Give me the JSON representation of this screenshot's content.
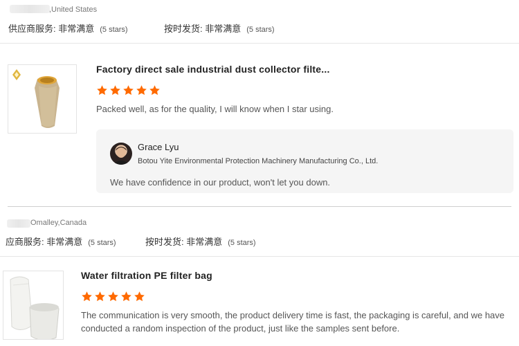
{
  "reviews": [
    {
      "location": ",United States",
      "supplier_service_label": "供应商服务: 非常满意",
      "supplier_service_note": "(5 stars)",
      "ontime_label": "按时发货: 非常满意",
      "ontime_note": "(5 stars)",
      "product_title": "Factory direct sale industrial dust collector filte...",
      "stars": 5,
      "text": "Packed well, as for the quality, I will know when I star using.",
      "reply": {
        "name": "Grace Lyu",
        "company": "Botou Yite Environmental Protection Machinery Manufacturing Co., Ltd.",
        "text": "We have confidence in our product, won't let you down."
      }
    },
    {
      "location": "Omalley,Canada",
      "supplier_service_label": "应商服务: 非常满意",
      "supplier_service_note": "(5 stars)",
      "ontime_label": "按时发货: 非常满意",
      "ontime_note": "(5 stars)",
      "product_title": "Water filtration PE filter bag",
      "stars": 5,
      "text": "The communication is very smooth, the product delivery time is fast, the packaging is careful, and we have conducted a random inspection of the product, just like the samples sent before."
    }
  ],
  "colors": {
    "star": "#ff6a00",
    "reply_bg": "#f5f5f5"
  }
}
